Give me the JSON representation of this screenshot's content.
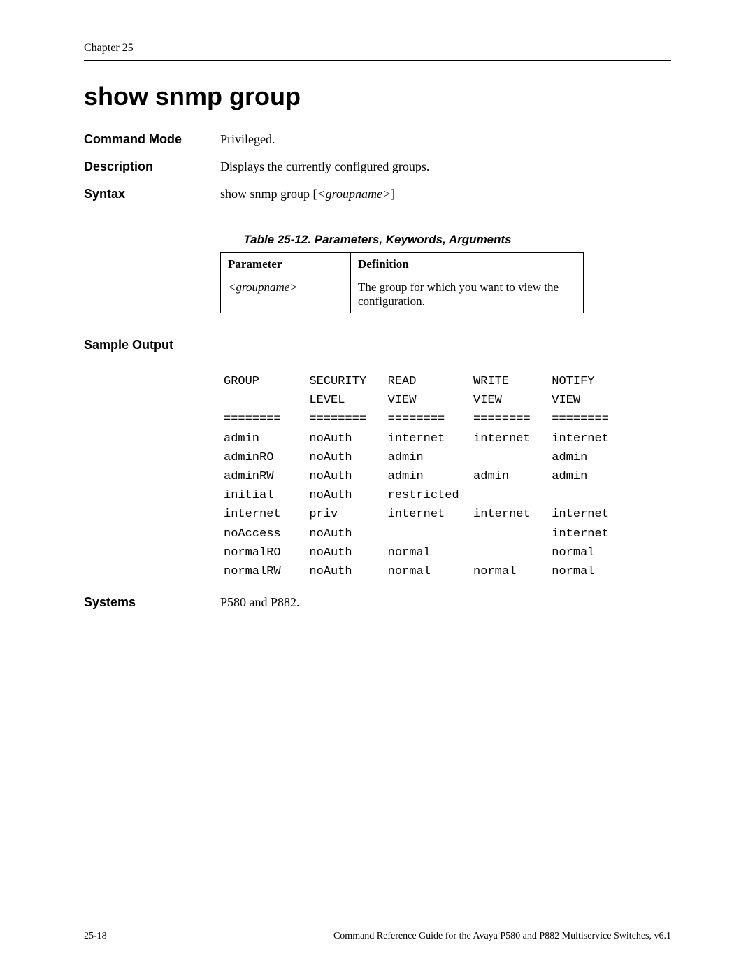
{
  "header": {
    "chapter": "Chapter 25"
  },
  "title": "show snmp group",
  "fields": {
    "command_mode_label": "Command Mode",
    "command_mode_value": "Privileged.",
    "description_label": "Description",
    "description_value": "Displays the currently configured groups.",
    "syntax_label": "Syntax",
    "syntax_prefix": "show snmp group [",
    "syntax_param": "<groupname>",
    "syntax_suffix": "]",
    "systems_label": "Systems",
    "systems_value": "P580 and P882."
  },
  "table": {
    "caption": "Table 25-12.  Parameters, Keywords, Arguments",
    "head_param": "Parameter",
    "head_def": "Definition",
    "rows": [
      {
        "param": "<groupname>",
        "def": "The group for which you want to view the configuration."
      }
    ]
  },
  "sample": {
    "heading": "Sample Output",
    "text": "GROUP       SECURITY   READ        WRITE      NOTIFY\n            LEVEL      VIEW        VIEW       VIEW\n========    ========   ========    ========   ========\nadmin       noAuth     internet    internet   internet\nadminRO     noAuth     admin                  admin\nadminRW     noAuth     admin       admin      admin\ninitial     noAuth     restricted\ninternet    priv       internet    internet   internet\nnoAccess    noAuth                            internet\nnormalRO    noAuth     normal                 normal\nnormalRW    noAuth     normal      normal     normal"
  },
  "footer": {
    "left": "25-18",
    "right": "Command Reference Guide for the Avaya P580 and P882 Multiservice Switches, v6.1"
  }
}
